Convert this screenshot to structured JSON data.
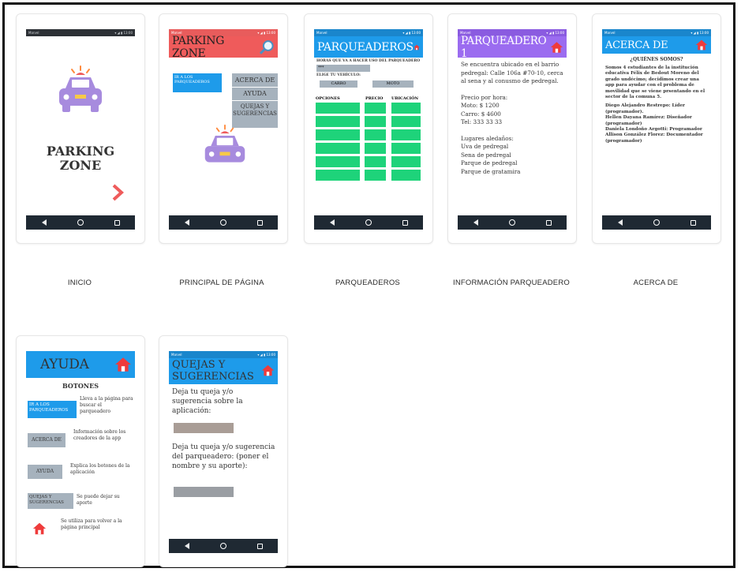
{
  "captions": {
    "inicio": "INICIO",
    "principal": "PRINCIPAL DE PÁGINA",
    "parqueaderos": "PARQUEADEROS",
    "informacion": "INFORMACIÓN PARQUEADERO",
    "acerca": "ACERCA DE"
  },
  "status": {
    "carrier": "Marvel",
    "time": "13:00"
  },
  "inicio": {
    "title_line1": "PARKING",
    "title_line2": "ZONE"
  },
  "principal": {
    "header": "PARKING ZONE",
    "ir_btn": "IR A LOS PARQUEADEROS",
    "acerca_btn": "ACERCA DE",
    "ayuda_btn": "AYUDA",
    "quejas_btn": "QUEJAS Y SUGERENCIAS"
  },
  "parqueaderos": {
    "header": "PARQUEADEROS",
    "horas_label": "HORAS QUE VA A HACER USO DEL PARQUEADERO",
    "horas_value": "***",
    "vehiculo_label": "ELIGE TU VEHÍCULO:",
    "carro_btn": "CARRO",
    "moto_btn": "MOTO",
    "col_opciones": "OPCIONES",
    "col_precio": "PRECIO",
    "col_ubicacion": "UBICACIÓN",
    "rows": 6
  },
  "info": {
    "header": "PARQUEADERO 1",
    "desc": "Se encuentra ubicado en el barrio pedregal: Calle 106a #70-10, cerca al sena y al conusmo de pedregal.",
    "precio_title": "Precio por hora:",
    "moto": "Moto: $ 1200",
    "carro": "Carro: $ 4600",
    "tel": "Tel: 333 33 33",
    "lugares_title": "Lugares aledaños:",
    "lugares": [
      "Uva de pedregal",
      "Sena de pedregal",
      "Parque de pedregal",
      "Parque de gratamira"
    ]
  },
  "acerca": {
    "header": "ACERCA DE",
    "subtitle": "¿QUIÉNES SOMOS?",
    "para": "Somos 4 estudiantes de la institución educativa Félix de Bedout Moreno del grado undécimo; decidimos crear una app para ayudar con el problema de movilidad que se viene prsentando en el sector de la comuna 5.",
    "members": [
      "Diego Alejandro Restrepo: Líder (programador).",
      "Hellen Dayana Ramírez: Diseñador (programador)",
      "Daniela Londoño Argotti: Programador",
      "Allison González Florez: Documentador (programador)"
    ]
  },
  "ayuda": {
    "header": "AYUDA",
    "subtitle": "BOTONES",
    "items": [
      {
        "btn": "IR A LOS PARQUEADEROS",
        "text": "Lleva a  la página para buscar el parqueadero"
      },
      {
        "btn": "ACERCA DE",
        "text": "Información sobre los creadores de la app"
      },
      {
        "btn": "AYUDA",
        "text": "Explica los  botones de la aplicación"
      },
      {
        "btn": "QUEJAS Y SUGERENCIAS",
        "text": "Se puede dejar su aporte"
      },
      {
        "btn": "",
        "text": "Se utiliza para volver a la página principal"
      }
    ]
  },
  "quejas": {
    "header_line1": "QUEJAS Y",
    "header_line2": "SUGERENCIAS",
    "label1": "Deja tu queja y/o sugerencia sobre la aplicación:",
    "label2": "Deja tu queja y/o sugerencia del parqueadero: (poner el nombre y su aporte):"
  },
  "colors": {
    "red": "#ef5b5b",
    "blue": "#1e9bea",
    "purple": "#9b6cf0",
    "green": "#1ed37a",
    "gray": "#a6b2bd",
    "car": "#a78bde"
  }
}
